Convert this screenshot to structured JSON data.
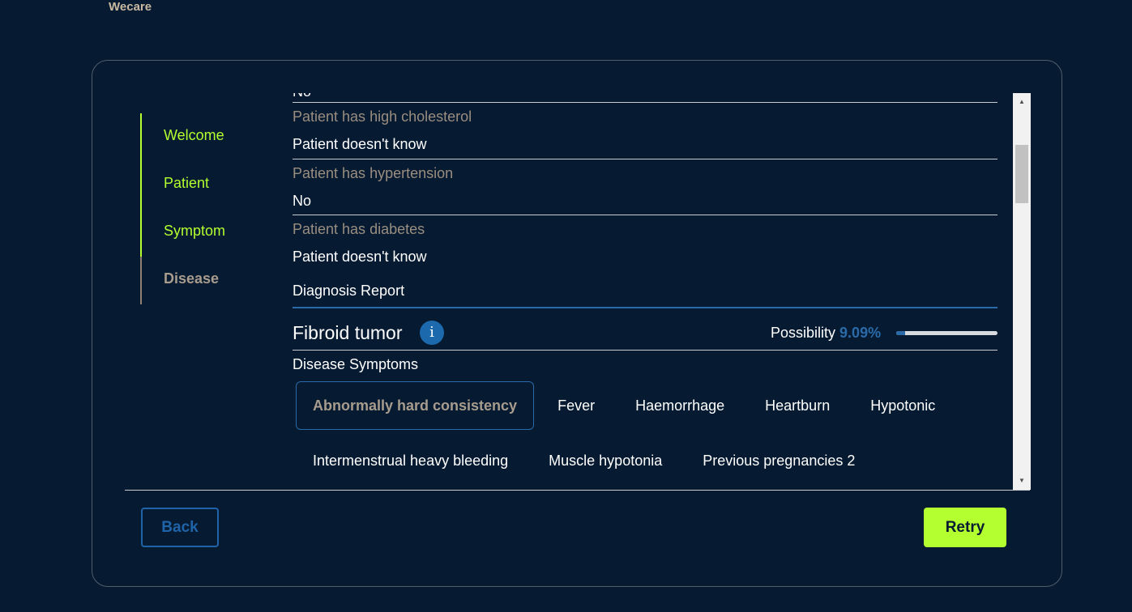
{
  "brand": "Wecare",
  "steps": [
    {
      "label": "Welcome",
      "state": "completed"
    },
    {
      "label": "Patient",
      "state": "completed"
    },
    {
      "label": "Symptom",
      "state": "completed"
    },
    {
      "label": "Disease",
      "state": "current"
    }
  ],
  "answers": {
    "clipped_answer": "No",
    "items": [
      {
        "question": "Patient has high cholesterol",
        "answer": "Patient doesn't know"
      },
      {
        "question": "Patient has hypertension",
        "answer": "No"
      },
      {
        "question": "Patient has diabetes",
        "answer": "Patient doesn't know"
      }
    ]
  },
  "report": {
    "title": "Diagnosis Report",
    "disease_name": "Fibroid tumor",
    "info_icon": "i",
    "possibility_label": "Possibility",
    "possibility_value": "9.09%",
    "possibility_fraction": 0.0909,
    "symptoms_title": "Disease Symptoms",
    "symptoms_row1": [
      {
        "label": "Abnormally hard consistency",
        "selected": true
      },
      {
        "label": "Fever",
        "selected": false
      },
      {
        "label": "Haemorrhage",
        "selected": false
      },
      {
        "label": "Heartburn",
        "selected": false
      },
      {
        "label": "Hypotonic",
        "selected": false
      }
    ],
    "symptoms_row2": [
      {
        "label": "Intermenstrual heavy bleeding",
        "selected": false
      },
      {
        "label": "Muscle hypotonia",
        "selected": false
      },
      {
        "label": "Previous pregnancies 2",
        "selected": false
      }
    ]
  },
  "buttons": {
    "back": "Back",
    "retry": "Retry"
  },
  "colors": {
    "background": "#061a31",
    "accent": "#b4ff2f",
    "primary_blue": "#2b6aa8",
    "muted_text": "#9a8e80"
  }
}
